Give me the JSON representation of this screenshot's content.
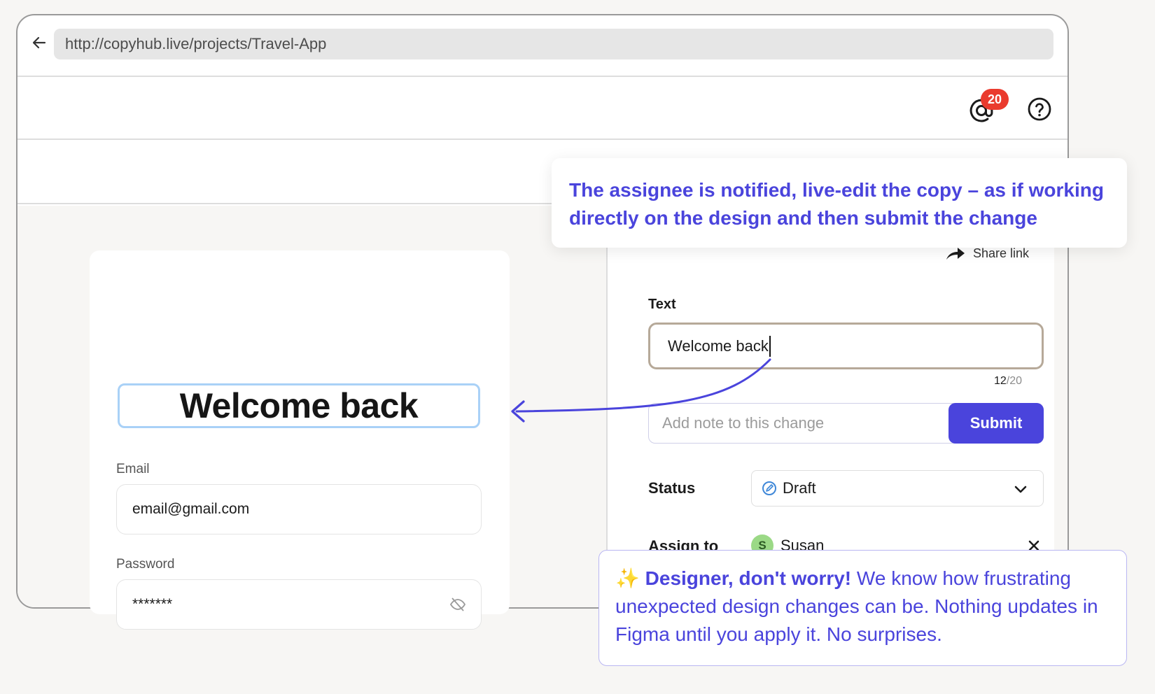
{
  "browser": {
    "url": "http://copyhub.live/projects/Travel-App",
    "mention_count": "20"
  },
  "login": {
    "title": "Welcome back",
    "email_label": "Email",
    "email_value": "email@gmail.com",
    "password_label": "Password",
    "password_value": "*******"
  },
  "panel": {
    "share_label": "Share link",
    "text_label": "Text",
    "text_value": "Welcome back",
    "char_count": "12",
    "char_max": "/20",
    "note_placeholder": "Add note to this change",
    "submit_label": "Submit",
    "status_label": "Status",
    "status_value": "Draft",
    "assign_label": "Assign to",
    "assignee_initial": "S",
    "assignee_name": "Susan"
  },
  "callouts": {
    "top": "The assignee is notified, live-edit the copy – as if working directly on the design and then submit the change",
    "bottom_emoji": "✨",
    "bottom_bold": "Designer, don't worry!",
    "bottom_text": " We know how frustrating unexpected design changes can be. Nothing updates in Figma until you apply it. No surprises."
  },
  "colors": {
    "accent": "#4a44dc",
    "badge": "#ea3b2e",
    "highlight": "#a9d1f7"
  }
}
